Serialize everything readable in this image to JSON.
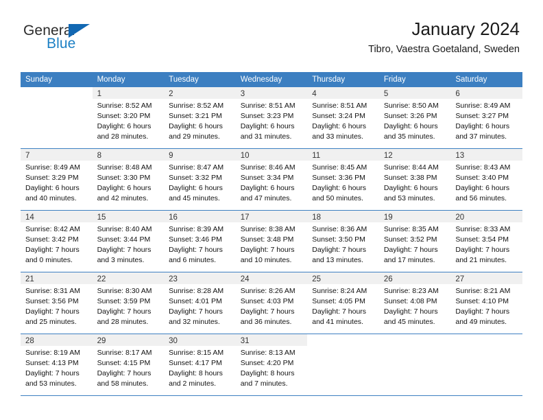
{
  "brand": {
    "name_top": "General",
    "name_bottom": "Blue",
    "color_blue": "#1b7fc4",
    "triangle_color": "#1268b3"
  },
  "header": {
    "title": "January 2024",
    "location": "Tibro, Vaestra Goetaland, Sweden"
  },
  "theme": {
    "header_row_bg": "#3c7fc1",
    "day_band_bg": "#f0f0f0",
    "grid_line": "#3c7fc1"
  },
  "weekdays": [
    "Sunday",
    "Monday",
    "Tuesday",
    "Wednesday",
    "Thursday",
    "Friday",
    "Saturday"
  ],
  "weeks": [
    [
      {
        "day": "",
        "sunrise": "",
        "sunset": "",
        "daylight_1": "",
        "daylight_2": ""
      },
      {
        "day": "1",
        "sunrise": "Sunrise: 8:52 AM",
        "sunset": "Sunset: 3:20 PM",
        "daylight_1": "Daylight: 6 hours",
        "daylight_2": "and 28 minutes."
      },
      {
        "day": "2",
        "sunrise": "Sunrise: 8:52 AM",
        "sunset": "Sunset: 3:21 PM",
        "daylight_1": "Daylight: 6 hours",
        "daylight_2": "and 29 minutes."
      },
      {
        "day": "3",
        "sunrise": "Sunrise: 8:51 AM",
        "sunset": "Sunset: 3:23 PM",
        "daylight_1": "Daylight: 6 hours",
        "daylight_2": "and 31 minutes."
      },
      {
        "day": "4",
        "sunrise": "Sunrise: 8:51 AM",
        "sunset": "Sunset: 3:24 PM",
        "daylight_1": "Daylight: 6 hours",
        "daylight_2": "and 33 minutes."
      },
      {
        "day": "5",
        "sunrise": "Sunrise: 8:50 AM",
        "sunset": "Sunset: 3:26 PM",
        "daylight_1": "Daylight: 6 hours",
        "daylight_2": "and 35 minutes."
      },
      {
        "day": "6",
        "sunrise": "Sunrise: 8:49 AM",
        "sunset": "Sunset: 3:27 PM",
        "daylight_1": "Daylight: 6 hours",
        "daylight_2": "and 37 minutes."
      }
    ],
    [
      {
        "day": "7",
        "sunrise": "Sunrise: 8:49 AM",
        "sunset": "Sunset: 3:29 PM",
        "daylight_1": "Daylight: 6 hours",
        "daylight_2": "and 40 minutes."
      },
      {
        "day": "8",
        "sunrise": "Sunrise: 8:48 AM",
        "sunset": "Sunset: 3:30 PM",
        "daylight_1": "Daylight: 6 hours",
        "daylight_2": "and 42 minutes."
      },
      {
        "day": "9",
        "sunrise": "Sunrise: 8:47 AM",
        "sunset": "Sunset: 3:32 PM",
        "daylight_1": "Daylight: 6 hours",
        "daylight_2": "and 45 minutes."
      },
      {
        "day": "10",
        "sunrise": "Sunrise: 8:46 AM",
        "sunset": "Sunset: 3:34 PM",
        "daylight_1": "Daylight: 6 hours",
        "daylight_2": "and 47 minutes."
      },
      {
        "day": "11",
        "sunrise": "Sunrise: 8:45 AM",
        "sunset": "Sunset: 3:36 PM",
        "daylight_1": "Daylight: 6 hours",
        "daylight_2": "and 50 minutes."
      },
      {
        "day": "12",
        "sunrise": "Sunrise: 8:44 AM",
        "sunset": "Sunset: 3:38 PM",
        "daylight_1": "Daylight: 6 hours",
        "daylight_2": "and 53 minutes."
      },
      {
        "day": "13",
        "sunrise": "Sunrise: 8:43 AM",
        "sunset": "Sunset: 3:40 PM",
        "daylight_1": "Daylight: 6 hours",
        "daylight_2": "and 56 minutes."
      }
    ],
    [
      {
        "day": "14",
        "sunrise": "Sunrise: 8:42 AM",
        "sunset": "Sunset: 3:42 PM",
        "daylight_1": "Daylight: 7 hours",
        "daylight_2": "and 0 minutes."
      },
      {
        "day": "15",
        "sunrise": "Sunrise: 8:40 AM",
        "sunset": "Sunset: 3:44 PM",
        "daylight_1": "Daylight: 7 hours",
        "daylight_2": "and 3 minutes."
      },
      {
        "day": "16",
        "sunrise": "Sunrise: 8:39 AM",
        "sunset": "Sunset: 3:46 PM",
        "daylight_1": "Daylight: 7 hours",
        "daylight_2": "and 6 minutes."
      },
      {
        "day": "17",
        "sunrise": "Sunrise: 8:38 AM",
        "sunset": "Sunset: 3:48 PM",
        "daylight_1": "Daylight: 7 hours",
        "daylight_2": "and 10 minutes."
      },
      {
        "day": "18",
        "sunrise": "Sunrise: 8:36 AM",
        "sunset": "Sunset: 3:50 PM",
        "daylight_1": "Daylight: 7 hours",
        "daylight_2": "and 13 minutes."
      },
      {
        "day": "19",
        "sunrise": "Sunrise: 8:35 AM",
        "sunset": "Sunset: 3:52 PM",
        "daylight_1": "Daylight: 7 hours",
        "daylight_2": "and 17 minutes."
      },
      {
        "day": "20",
        "sunrise": "Sunrise: 8:33 AM",
        "sunset": "Sunset: 3:54 PM",
        "daylight_1": "Daylight: 7 hours",
        "daylight_2": "and 21 minutes."
      }
    ],
    [
      {
        "day": "21",
        "sunrise": "Sunrise: 8:31 AM",
        "sunset": "Sunset: 3:56 PM",
        "daylight_1": "Daylight: 7 hours",
        "daylight_2": "and 25 minutes."
      },
      {
        "day": "22",
        "sunrise": "Sunrise: 8:30 AM",
        "sunset": "Sunset: 3:59 PM",
        "daylight_1": "Daylight: 7 hours",
        "daylight_2": "and 28 minutes."
      },
      {
        "day": "23",
        "sunrise": "Sunrise: 8:28 AM",
        "sunset": "Sunset: 4:01 PM",
        "daylight_1": "Daylight: 7 hours",
        "daylight_2": "and 32 minutes."
      },
      {
        "day": "24",
        "sunrise": "Sunrise: 8:26 AM",
        "sunset": "Sunset: 4:03 PM",
        "daylight_1": "Daylight: 7 hours",
        "daylight_2": "and 36 minutes."
      },
      {
        "day": "25",
        "sunrise": "Sunrise: 8:24 AM",
        "sunset": "Sunset: 4:05 PM",
        "daylight_1": "Daylight: 7 hours",
        "daylight_2": "and 41 minutes."
      },
      {
        "day": "26",
        "sunrise": "Sunrise: 8:23 AM",
        "sunset": "Sunset: 4:08 PM",
        "daylight_1": "Daylight: 7 hours",
        "daylight_2": "and 45 minutes."
      },
      {
        "day": "27",
        "sunrise": "Sunrise: 8:21 AM",
        "sunset": "Sunset: 4:10 PM",
        "daylight_1": "Daylight: 7 hours",
        "daylight_2": "and 49 minutes."
      }
    ],
    [
      {
        "day": "28",
        "sunrise": "Sunrise: 8:19 AM",
        "sunset": "Sunset: 4:13 PM",
        "daylight_1": "Daylight: 7 hours",
        "daylight_2": "and 53 minutes."
      },
      {
        "day": "29",
        "sunrise": "Sunrise: 8:17 AM",
        "sunset": "Sunset: 4:15 PM",
        "daylight_1": "Daylight: 7 hours",
        "daylight_2": "and 58 minutes."
      },
      {
        "day": "30",
        "sunrise": "Sunrise: 8:15 AM",
        "sunset": "Sunset: 4:17 PM",
        "daylight_1": "Daylight: 8 hours",
        "daylight_2": "and 2 minutes."
      },
      {
        "day": "31",
        "sunrise": "Sunrise: 8:13 AM",
        "sunset": "Sunset: 4:20 PM",
        "daylight_1": "Daylight: 8 hours",
        "daylight_2": "and 7 minutes."
      },
      {
        "day": "",
        "sunrise": "",
        "sunset": "",
        "daylight_1": "",
        "daylight_2": ""
      },
      {
        "day": "",
        "sunrise": "",
        "sunset": "",
        "daylight_1": "",
        "daylight_2": ""
      },
      {
        "day": "",
        "sunrise": "",
        "sunset": "",
        "daylight_1": "",
        "daylight_2": ""
      }
    ]
  ]
}
